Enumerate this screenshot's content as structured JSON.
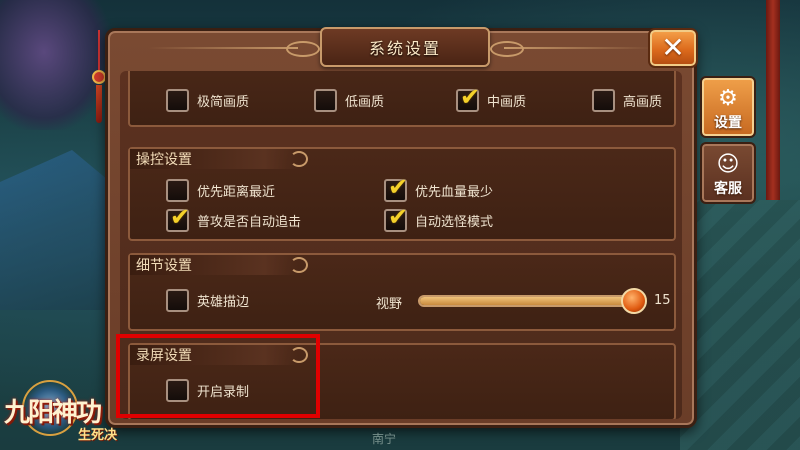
{
  "dialog": {
    "title": "系统设置",
    "close_label": "✕"
  },
  "quality": {
    "options": [
      {
        "label": "极简画质",
        "checked": false
      },
      {
        "label": "低画质",
        "checked": false
      },
      {
        "label": "中画质",
        "checked": true
      },
      {
        "label": "高画质",
        "checked": false
      }
    ]
  },
  "controls": {
    "heading": "操控设置",
    "options": [
      {
        "label": "优先距离最近",
        "checked": false
      },
      {
        "label": "优先血量最少",
        "checked": true
      },
      {
        "label": "普攻是否自动追击",
        "checked": true
      },
      {
        "label": "自动选怪模式",
        "checked": true
      }
    ]
  },
  "details": {
    "heading": "细节设置",
    "hero_outline": {
      "label": "英雄描边",
      "checked": false
    },
    "view_range": {
      "label": "视野",
      "value": 15,
      "max": 15
    }
  },
  "recording": {
    "heading": "录屏设置",
    "enable": {
      "label": "开启录制",
      "checked": false
    }
  },
  "side_tabs": [
    {
      "label": "设置",
      "icon": "gears-icon",
      "active": true
    },
    {
      "label": "客服",
      "icon": "support-agent-icon",
      "active": false
    }
  ],
  "logo": {
    "main": "九阳神功",
    "sub": "生死决"
  },
  "bottom_hint": "南宁",
  "colors": {
    "highlight": "#e00000",
    "checkmark": "#f4d12a",
    "active_tab": "#e38a36"
  }
}
